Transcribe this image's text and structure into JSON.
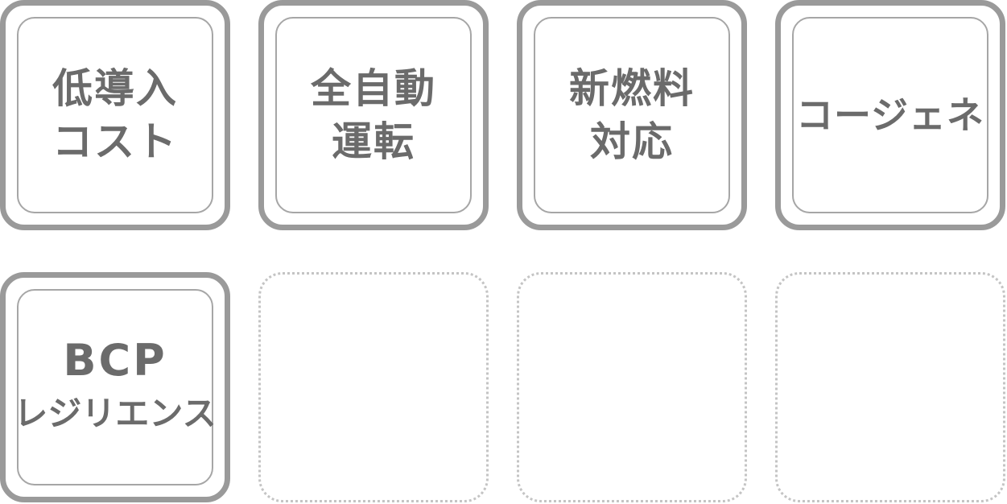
{
  "tiles": [
    {
      "lines": [
        "低導入",
        "コスト"
      ]
    },
    {
      "lines": [
        "全自動",
        "運転"
      ]
    },
    {
      "lines": [
        "新燃料",
        "対応"
      ]
    },
    {
      "lines": [
        "コージェネ"
      ]
    },
    {
      "lines": [
        "BCP",
        "レジリエンス"
      ]
    }
  ],
  "colors": {
    "tile_border": "#9a9a9a",
    "inner_border": "#a6a6a6",
    "text": "#6b6b6b",
    "empty_dotted_border": "#c4c4c4"
  }
}
